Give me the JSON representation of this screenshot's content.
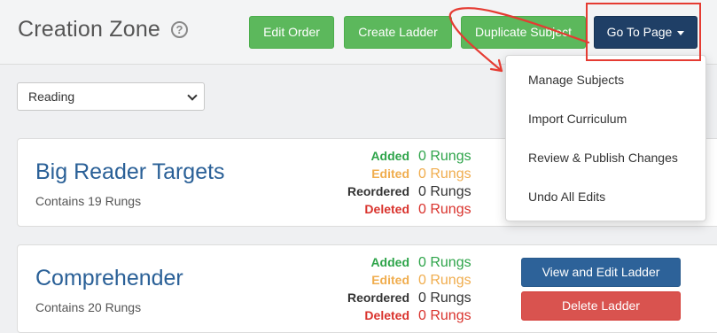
{
  "header": {
    "title": "Creation Zone",
    "help_glyph": "?",
    "buttons": {
      "edit_order": "Edit Order",
      "create_ladder": "Create Ladder",
      "duplicate_subject": "Duplicate Subject",
      "go_to_page": "Go To Page"
    }
  },
  "subject_select": {
    "value": "Reading"
  },
  "dropdown_menu": {
    "items": [
      "Manage Subjects",
      "Import Curriculum",
      "Review & Publish Changes",
      "Undo All Edits"
    ]
  },
  "cards": [
    {
      "title": "Big Reader Targets",
      "subtitle": "Contains 19 Rungs",
      "stats": [
        {
          "label": "Added",
          "value": "0 Rungs"
        },
        {
          "label": "Edited",
          "value": "0 Rungs"
        },
        {
          "label": "Reordered",
          "value": "0 Rungs"
        },
        {
          "label": "Deleted",
          "value": "0 Rungs"
        }
      ]
    },
    {
      "title": "Comprehender",
      "subtitle": "Contains 20 Rungs",
      "stats": [
        {
          "label": "Added",
          "value": "0 Rungs"
        },
        {
          "label": "Edited",
          "value": "0 Rungs"
        },
        {
          "label": "Reordered",
          "value": "0 Rungs"
        },
        {
          "label": "Deleted",
          "value": "0 Rungs"
        }
      ],
      "actions": {
        "view_edit": "View and Edit Ladder",
        "delete": "Delete Ladder"
      }
    }
  ],
  "colors": {
    "accent_green": "#5cb85c",
    "nav_button": "#1f3f66",
    "title_blue": "#2a6097",
    "added": "#2ea44a",
    "edited": "#f0ad4e",
    "deleted": "#d9322c",
    "annotation_red": "#e53b32"
  }
}
